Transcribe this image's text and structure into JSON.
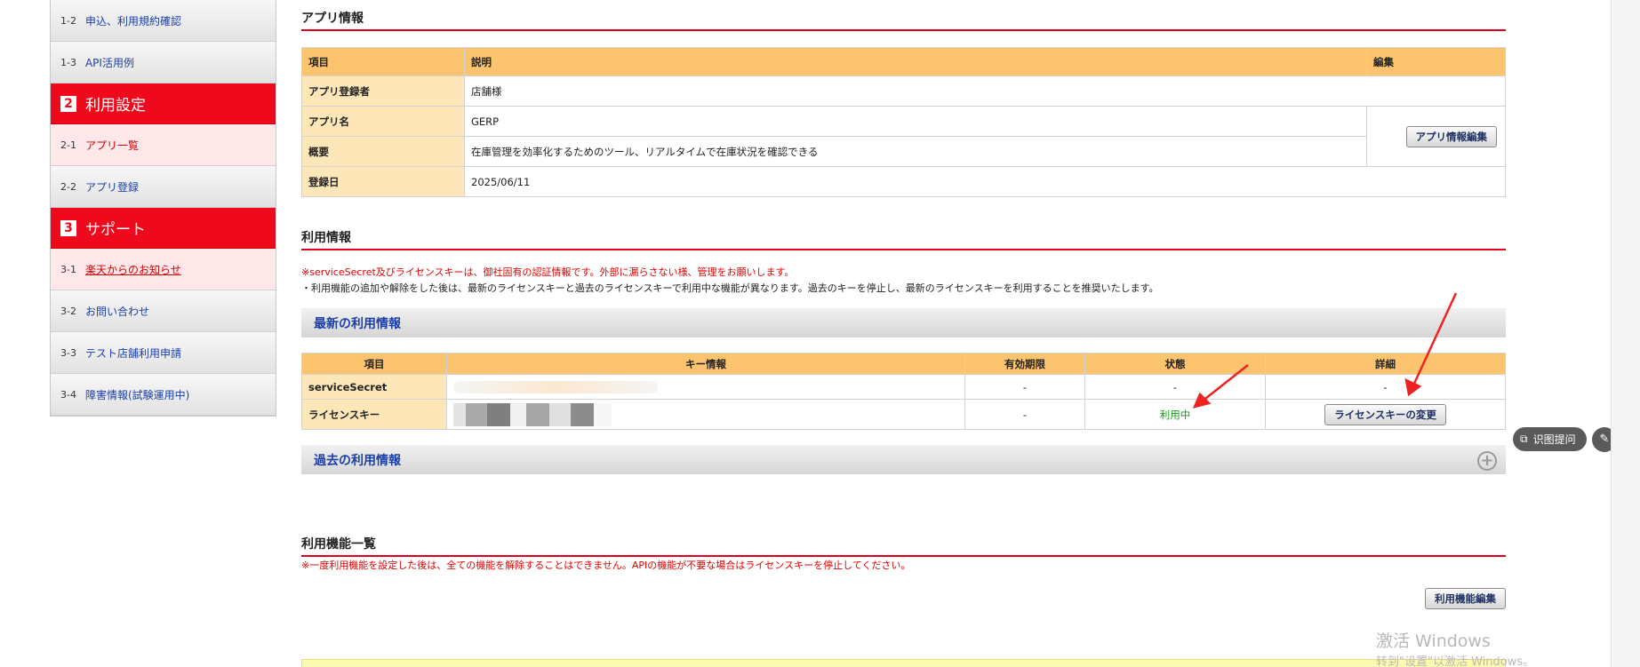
{
  "sidebar": {
    "items_top": [
      {
        "num": "1-2",
        "label": "申込、利用規約確認"
      },
      {
        "num": "1-3",
        "label": "API活用例"
      }
    ],
    "section2": {
      "num": "2",
      "label": "利用設定"
    },
    "items_2": [
      {
        "num": "2-1",
        "label": "アプリ一覧"
      },
      {
        "num": "2-2",
        "label": "アプリ登録"
      }
    ],
    "section3": {
      "num": "3",
      "label": "サポート"
    },
    "items_3": [
      {
        "num": "3-1",
        "label": "楽天からのお知らせ"
      },
      {
        "num": "3-2",
        "label": "お問い合わせ"
      },
      {
        "num": "3-3",
        "label": "テスト店舗利用申請"
      },
      {
        "num": "3-4",
        "label": "障害情報(試験運用中)"
      }
    ]
  },
  "app_info": {
    "title": "アプリ情報",
    "headers": {
      "item": "項目",
      "desc": "説明",
      "edit": "編集"
    },
    "rows": [
      {
        "label": "アプリ登録者",
        "value": "店舗様"
      },
      {
        "label": "アプリ名",
        "value": "GERP"
      },
      {
        "label": "概要",
        "value": "在庫管理を効率化するためのツール、リアルタイムで在庫状況を確認できる"
      },
      {
        "label": "登録日",
        "value": "2025/06/11"
      }
    ],
    "edit_button": "アプリ情報編集"
  },
  "usage_info": {
    "title": "利用情報",
    "notice_red": "※serviceSecret及びライセンスキーは、御社固有の認証情報です。外部に漏らさない様、管理をお願いします。",
    "notice_black": "・利用機能の追加や解除をした後は、最新のライセンスキーと過去のライセンスキーで利用中な機能が異なります。過去のキーを停止し、最新のライセンスキーを利用することを推奨いたします。",
    "latest_bar": "最新の利用情報",
    "headers": {
      "item": "項目",
      "key": "キー情報",
      "expiry": "有効期限",
      "status": "状態",
      "detail": "詳細"
    },
    "rows": [
      {
        "label": "serviceSecret",
        "expiry": "-",
        "status": "-",
        "detail": "-"
      },
      {
        "label": "ライセンスキー",
        "expiry": "-",
        "status": "利用中",
        "detail_button": "ライセンスキーの変更"
      }
    ],
    "past_bar": "過去の利用情報"
  },
  "features": {
    "title": "利用機能一覧",
    "notice": "※一度利用機能を設定した後は、全ての機能を解除することはできません。APIの機能が不要な場合はライセンスキーを停止してください。",
    "edit_button": "利用機能編集"
  },
  "overlay": {
    "pill_label": "识图提问",
    "watermark": "激活 Windows",
    "watermark_sub": "转到\"设置\"以激活 Windows。"
  },
  "colors": {
    "accent_red": "#e0001b",
    "table_header": "#fcc46e",
    "label_cell": "#fde6b8",
    "status_green": "#1a9b1a"
  }
}
